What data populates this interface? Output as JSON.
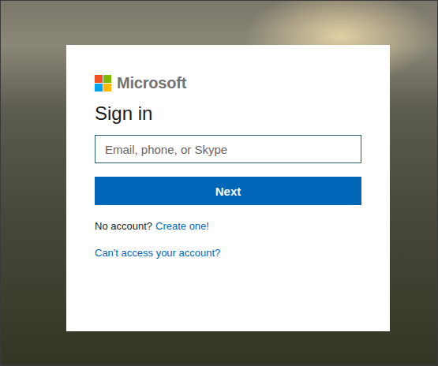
{
  "brand": {
    "name": "Microsoft"
  },
  "heading": "Sign in",
  "input": {
    "placeholder": "Email, phone, or Skype",
    "value": ""
  },
  "primary_button": "Next",
  "signup": {
    "prompt": "No account?",
    "link": "Create one!"
  },
  "help_link": "Can't access your account?"
}
